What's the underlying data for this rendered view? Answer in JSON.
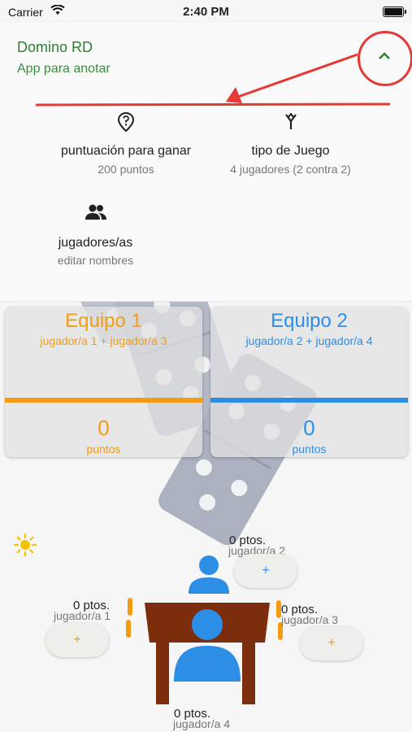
{
  "status": {
    "carrier": "Carrier",
    "time": "2:40 PM"
  },
  "header": {
    "title": "Domino RD",
    "subtitle": "App para anotar"
  },
  "options": [
    {
      "title": "puntuación para ganar",
      "subtitle": "200 puntos",
      "icon": "location-question-icon"
    },
    {
      "title": "tipo de Juego",
      "subtitle": "4 jugadores (2 contra 2)",
      "icon": "merge-icon"
    },
    {
      "title": "jugadores/as",
      "subtitle": "editar nombres",
      "icon": "people-icon"
    }
  ],
  "teams": [
    {
      "name": "Equipo 1",
      "players": "jugador/a 1 + jugador/a 3",
      "score": "0",
      "points_label": "puntos",
      "color": "#f39c12"
    },
    {
      "name": "Equipo 2",
      "players": "jugador/a 2 + jugador/a 4",
      "score": "0",
      "points_label": "puntos",
      "color": "#2d8ee6"
    }
  ],
  "table": {
    "player1": {
      "points": "0 ptos.",
      "name": "jugador/a 1",
      "add": "+"
    },
    "player2": {
      "points": "0 ptos.",
      "name": "jugador/a 2",
      "add": "+"
    },
    "player3": {
      "points": "0 ptos.",
      "name": "jugador/a 3",
      "add": "+"
    },
    "player4": {
      "points": "0 ptos.",
      "name": "jugador/a 4"
    }
  }
}
